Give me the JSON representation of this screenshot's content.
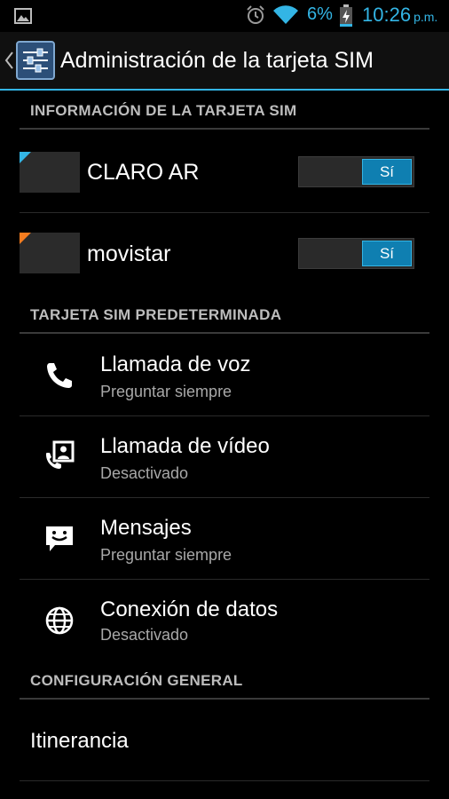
{
  "status_bar": {
    "battery_percent": "6%",
    "time": "10:26",
    "ampm": "p.m.",
    "accent_color": "#33b5e5",
    "icons": [
      "gallery-icon",
      "alarm-icon",
      "wifi-icon",
      "battery-charging-icon"
    ]
  },
  "action_bar": {
    "title": "Administración de la tarjeta SIM",
    "icons": [
      "back-chevron-icon",
      "sim-settings-app-icon"
    ]
  },
  "sections": {
    "sim_info": "INFORMACIÓN DE LA TARJETA SIM",
    "default_sim": "TARJETA SIM PREDETERMINADA",
    "general": "CONFIGURACIÓN GENERAL"
  },
  "sims": [
    {
      "name": "CLARO AR",
      "toggle_label": "Sí",
      "enabled": true,
      "color": "#33b5e5"
    },
    {
      "name": "movistar",
      "toggle_label": "Sí",
      "enabled": true,
      "color": "#f57c1f"
    }
  ],
  "default_prefs": [
    {
      "icon": "phone-icon",
      "title": "Llamada de voz",
      "summary": "Preguntar siempre"
    },
    {
      "icon": "video-call-icon",
      "title": "Llamada de vídeo",
      "summary": "Desactivado"
    },
    {
      "icon": "message-icon",
      "title": "Mensajes",
      "summary": "Preguntar siempre"
    },
    {
      "icon": "globe-icon",
      "title": "Conexión de datos",
      "summary": "Desactivado"
    }
  ],
  "general": {
    "roaming_title": "Itinerancia"
  }
}
